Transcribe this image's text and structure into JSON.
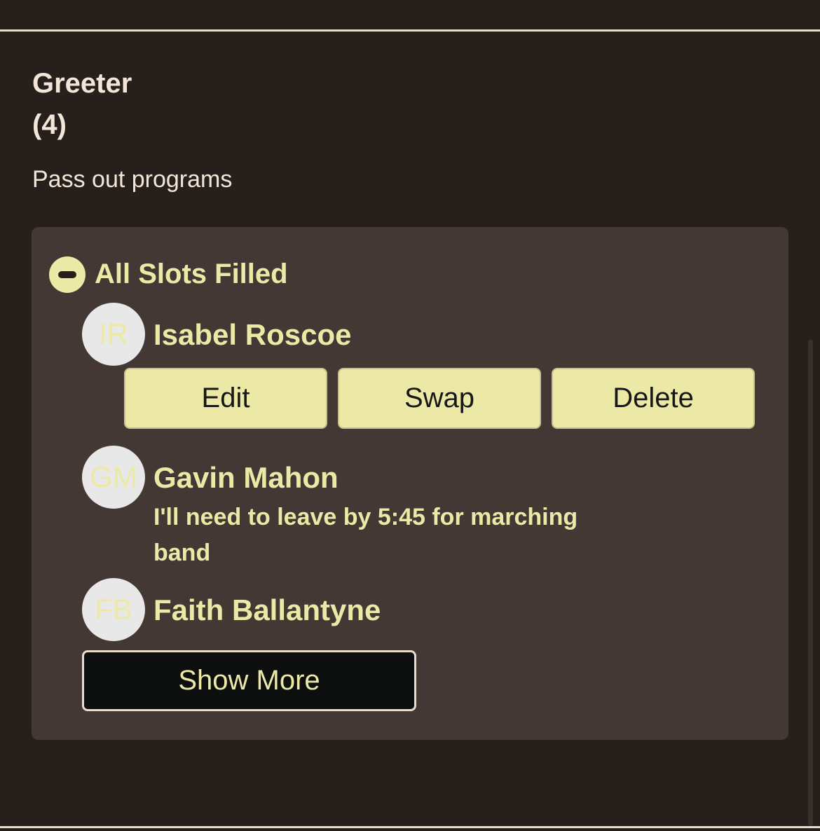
{
  "role": {
    "title": "Greeter",
    "count": "(4)",
    "description": "Pass out programs"
  },
  "slots": {
    "status": "All Slots Filled",
    "volunteers": [
      {
        "initials": "IR",
        "name": "Isabel Roscoe",
        "note": ""
      },
      {
        "initials": "GM",
        "name": "Gavin Mahon",
        "note": "I'll need to leave by 5:45 for marching band"
      },
      {
        "initials": "FB",
        "name": "Faith Ballantyne",
        "note": ""
      }
    ],
    "actions": {
      "edit": "Edit",
      "swap": "Swap",
      "delete": "Delete"
    },
    "show_more": "Show More"
  },
  "colors": {
    "background": "#271f1b",
    "panel": "#433834",
    "accent": "#ece9a6",
    "text_light": "#f2e6d8"
  },
  "icons": {
    "collapse": "minus-circle-icon"
  }
}
